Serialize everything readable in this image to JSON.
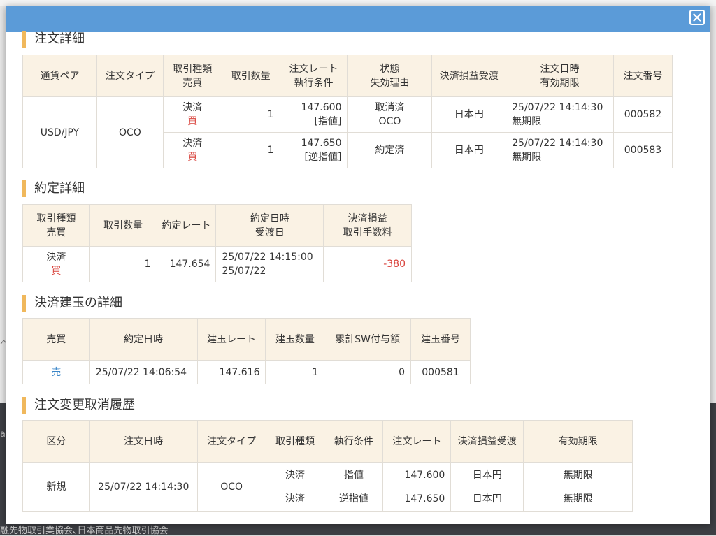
{
  "background": {
    "footer_text": "融先物取引業協会､日本商品先物取引協会",
    "side_glyph_left": "ペ",
    "side_glyph_left2": "a"
  },
  "modal": {
    "close_icon": "close-icon"
  },
  "order_detail": {
    "title": "注文詳細",
    "headers": {
      "pair": "通貨ペア",
      "order_type": "注文タイプ",
      "trade_kind": "取引種類",
      "side": "売買",
      "qty": "取引数量",
      "rate": "注文レート",
      "exec_cond": "執行条件",
      "status": "状態",
      "invalid_reason": "失効理由",
      "settle_ccy": "決済損益受渡",
      "order_dt": "注文日時",
      "expiry": "有効期限",
      "order_no": "注文番号"
    },
    "pair": "USD/JPY",
    "order_type": "OCO",
    "rows": [
      {
        "kind": "決済",
        "side": "買",
        "qty": "1",
        "rate": "147.600",
        "cond": "[指値]",
        "status": "取消済",
        "reason": "OCO",
        "ccy": "日本円",
        "dt": "25/07/22 14:14:30",
        "expiry": "無期限",
        "no": "000582"
      },
      {
        "kind": "決済",
        "side": "買",
        "qty": "1",
        "rate": "147.650",
        "cond": "[逆指値]",
        "status": "約定済",
        "reason": "",
        "ccy": "日本円",
        "dt": "25/07/22 14:14:30",
        "expiry": "無期限",
        "no": "000583"
      }
    ]
  },
  "exec_detail": {
    "title": "約定詳細",
    "headers": {
      "trade_kind": "取引種類",
      "side": "売買",
      "qty": "取引数量",
      "rate": "約定レート",
      "exec_dt": "約定日時",
      "settle_date": "受渡日",
      "pl": "決済損益",
      "fee": "取引手数料"
    },
    "row": {
      "kind": "決済",
      "side": "買",
      "qty": "1",
      "rate": "147.654",
      "dt": "25/07/22 14:15:00",
      "settle": "25/07/22",
      "pl": "-380"
    }
  },
  "position_detail": {
    "title": "決済建玉の詳細",
    "headers": {
      "side": "売買",
      "exec_dt": "約定日時",
      "rate": "建玉レート",
      "qty": "建玉数量",
      "swap": "累計SW付与額",
      "pos_no": "建玉番号"
    },
    "row": {
      "side": "売",
      "dt": "25/07/22 14:06:54",
      "rate": "147.616",
      "qty": "1",
      "swap": "0",
      "no": "000581"
    }
  },
  "history": {
    "title": "注文変更取消履歴",
    "headers": {
      "category": "区分",
      "order_dt": "注文日時",
      "order_type": "注文タイプ",
      "trade_kind": "取引種類",
      "exec_cond": "執行条件",
      "rate": "注文レート",
      "settle_ccy": "決済損益受渡",
      "expiry": "有効期限"
    },
    "category": "新規",
    "dt": "25/07/22 14:14:30",
    "order_type": "OCO",
    "lines": [
      {
        "kind": "決済",
        "cond": "指値",
        "rate": "147.600",
        "ccy": "日本円",
        "expiry": "無期限"
      },
      {
        "kind": "決済",
        "cond": "逆指値",
        "rate": "147.650",
        "ccy": "日本円",
        "expiry": "無期限"
      }
    ]
  }
}
